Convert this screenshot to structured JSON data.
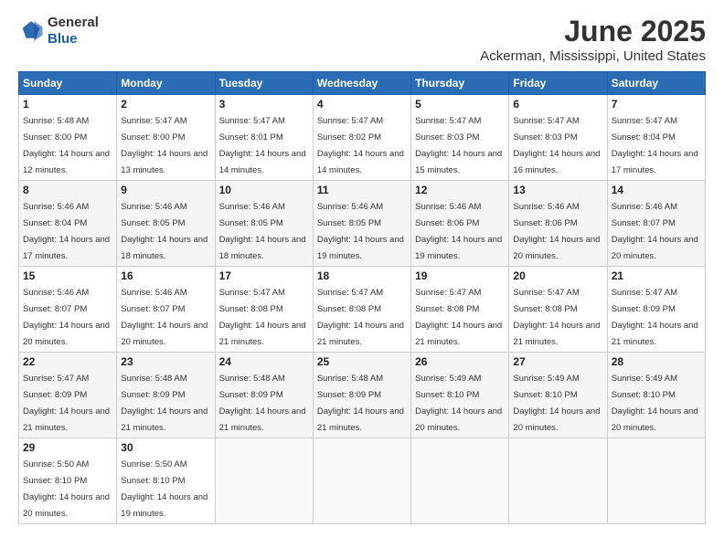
{
  "header": {
    "logo": {
      "general": "General",
      "blue": "Blue"
    },
    "title": "June 2025",
    "subtitle": "Ackerman, Mississippi, United States"
  },
  "calendar": {
    "headers": [
      "Sunday",
      "Monday",
      "Tuesday",
      "Wednesday",
      "Thursday",
      "Friday",
      "Saturday"
    ],
    "weeks": [
      [
        {
          "day": "1",
          "sunrise": "5:48 AM",
          "sunset": "8:00 PM",
          "daylight": "14 hours and 12 minutes."
        },
        {
          "day": "2",
          "sunrise": "5:47 AM",
          "sunset": "8:00 PM",
          "daylight": "14 hours and 13 minutes."
        },
        {
          "day": "3",
          "sunrise": "5:47 AM",
          "sunset": "8:01 PM",
          "daylight": "14 hours and 14 minutes."
        },
        {
          "day": "4",
          "sunrise": "5:47 AM",
          "sunset": "8:02 PM",
          "daylight": "14 hours and 14 minutes."
        },
        {
          "day": "5",
          "sunrise": "5:47 AM",
          "sunset": "8:03 PM",
          "daylight": "14 hours and 15 minutes."
        },
        {
          "day": "6",
          "sunrise": "5:47 AM",
          "sunset": "8:03 PM",
          "daylight": "14 hours and 16 minutes."
        },
        {
          "day": "7",
          "sunrise": "5:47 AM",
          "sunset": "8:04 PM",
          "daylight": "14 hours and 17 minutes."
        }
      ],
      [
        {
          "day": "8",
          "sunrise": "5:46 AM",
          "sunset": "8:04 PM",
          "daylight": "14 hours and 17 minutes."
        },
        {
          "day": "9",
          "sunrise": "5:46 AM",
          "sunset": "8:05 PM",
          "daylight": "14 hours and 18 minutes."
        },
        {
          "day": "10",
          "sunrise": "5:46 AM",
          "sunset": "8:05 PM",
          "daylight": "14 hours and 18 minutes."
        },
        {
          "day": "11",
          "sunrise": "5:46 AM",
          "sunset": "8:05 PM",
          "daylight": "14 hours and 19 minutes."
        },
        {
          "day": "12",
          "sunrise": "5:46 AM",
          "sunset": "8:06 PM",
          "daylight": "14 hours and 19 minutes."
        },
        {
          "day": "13",
          "sunrise": "5:46 AM",
          "sunset": "8:06 PM",
          "daylight": "14 hours and 20 minutes."
        },
        {
          "day": "14",
          "sunrise": "5:46 AM",
          "sunset": "8:07 PM",
          "daylight": "14 hours and 20 minutes."
        }
      ],
      [
        {
          "day": "15",
          "sunrise": "5:46 AM",
          "sunset": "8:07 PM",
          "daylight": "14 hours and 20 minutes."
        },
        {
          "day": "16",
          "sunrise": "5:46 AM",
          "sunset": "8:07 PM",
          "daylight": "14 hours and 20 minutes."
        },
        {
          "day": "17",
          "sunrise": "5:47 AM",
          "sunset": "8:08 PM",
          "daylight": "14 hours and 21 minutes."
        },
        {
          "day": "18",
          "sunrise": "5:47 AM",
          "sunset": "8:08 PM",
          "daylight": "14 hours and 21 minutes."
        },
        {
          "day": "19",
          "sunrise": "5:47 AM",
          "sunset": "8:08 PM",
          "daylight": "14 hours and 21 minutes."
        },
        {
          "day": "20",
          "sunrise": "5:47 AM",
          "sunset": "8:08 PM",
          "daylight": "14 hours and 21 minutes."
        },
        {
          "day": "21",
          "sunrise": "5:47 AM",
          "sunset": "8:09 PM",
          "daylight": "14 hours and 21 minutes."
        }
      ],
      [
        {
          "day": "22",
          "sunrise": "5:47 AM",
          "sunset": "8:09 PM",
          "daylight": "14 hours and 21 minutes."
        },
        {
          "day": "23",
          "sunrise": "5:48 AM",
          "sunset": "8:09 PM",
          "daylight": "14 hours and 21 minutes."
        },
        {
          "day": "24",
          "sunrise": "5:48 AM",
          "sunset": "8:09 PM",
          "daylight": "14 hours and 21 minutes."
        },
        {
          "day": "25",
          "sunrise": "5:48 AM",
          "sunset": "8:09 PM",
          "daylight": "14 hours and 21 minutes."
        },
        {
          "day": "26",
          "sunrise": "5:49 AM",
          "sunset": "8:10 PM",
          "daylight": "14 hours and 20 minutes."
        },
        {
          "day": "27",
          "sunrise": "5:49 AM",
          "sunset": "8:10 PM",
          "daylight": "14 hours and 20 minutes."
        },
        {
          "day": "28",
          "sunrise": "5:49 AM",
          "sunset": "8:10 PM",
          "daylight": "14 hours and 20 minutes."
        }
      ],
      [
        {
          "day": "29",
          "sunrise": "5:50 AM",
          "sunset": "8:10 PM",
          "daylight": "14 hours and 20 minutes."
        },
        {
          "day": "30",
          "sunrise": "5:50 AM",
          "sunset": "8:10 PM",
          "daylight": "14 hours and 19 minutes."
        },
        {
          "day": "",
          "sunrise": "",
          "sunset": "",
          "daylight": ""
        },
        {
          "day": "",
          "sunrise": "",
          "sunset": "",
          "daylight": ""
        },
        {
          "day": "",
          "sunrise": "",
          "sunset": "",
          "daylight": ""
        },
        {
          "day": "",
          "sunrise": "",
          "sunset": "",
          "daylight": ""
        },
        {
          "day": "",
          "sunrise": "",
          "sunset": "",
          "daylight": ""
        }
      ]
    ]
  }
}
